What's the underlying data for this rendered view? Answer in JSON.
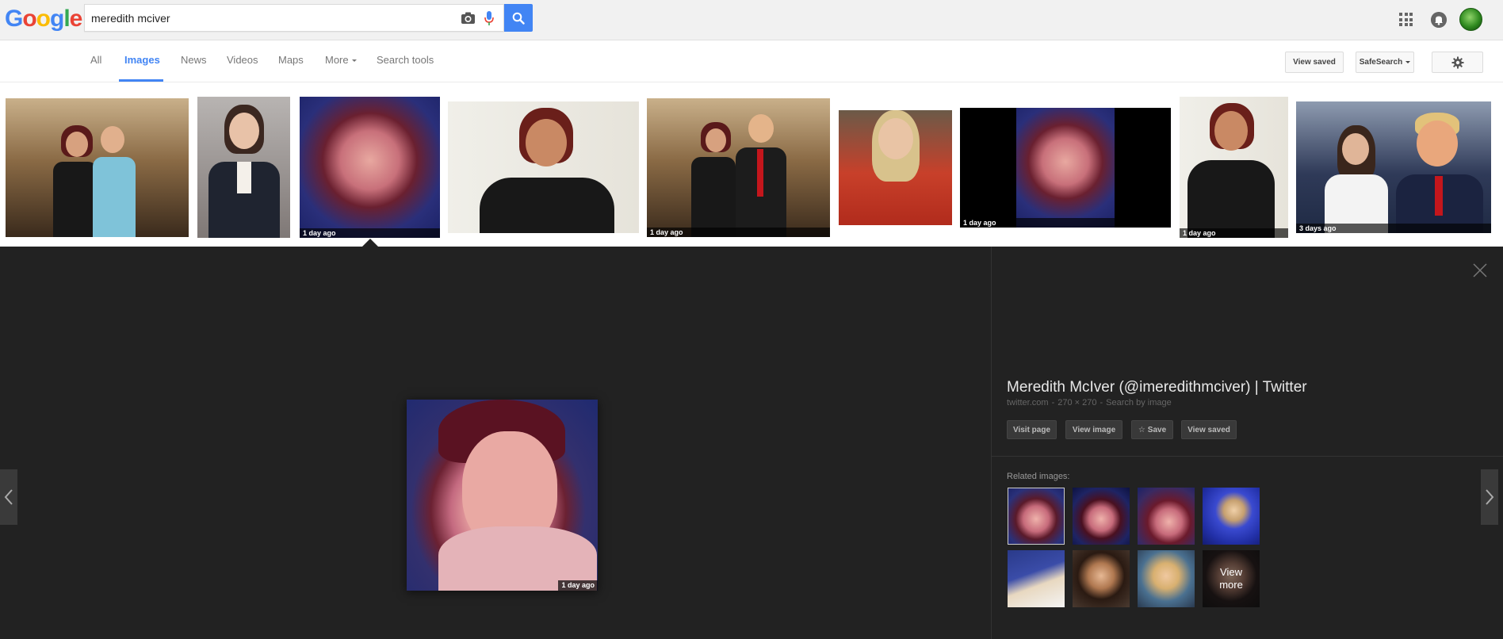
{
  "search": {
    "query": "meredith mciver"
  },
  "nav": {
    "tabs": [
      {
        "label": "All",
        "active": false
      },
      {
        "label": "Images",
        "active": true
      },
      {
        "label": "News",
        "active": false
      },
      {
        "label": "Videos",
        "active": false
      },
      {
        "label": "Maps",
        "active": false
      },
      {
        "label": "More",
        "active": false
      },
      {
        "label": "Search tools",
        "active": false
      }
    ],
    "view_saved": "View saved",
    "safesearch": "SafeSearch"
  },
  "strip": {
    "ages": {
      "t3": "1 day ago",
      "t5": "1 day ago",
      "t7": "1 day ago",
      "t8": "1 day ago",
      "t9": "3 days ago"
    }
  },
  "viewer": {
    "image_age": "1 day ago",
    "title": "Meredith McIver (@imeredithmciver) | Twitter",
    "source": "twitter.com",
    "dimensions": "270 × 270",
    "search_by_image": "Search by image",
    "actions": {
      "visit_page": "Visit page",
      "view_image": "View image",
      "save": "Save",
      "view_saved": "View saved"
    },
    "related_label": "Related images:",
    "view_more": "View more"
  },
  "colors": {
    "accent": "#4285f4",
    "viewer_bg": "#222222",
    "header_bg": "#f1f1f1"
  }
}
